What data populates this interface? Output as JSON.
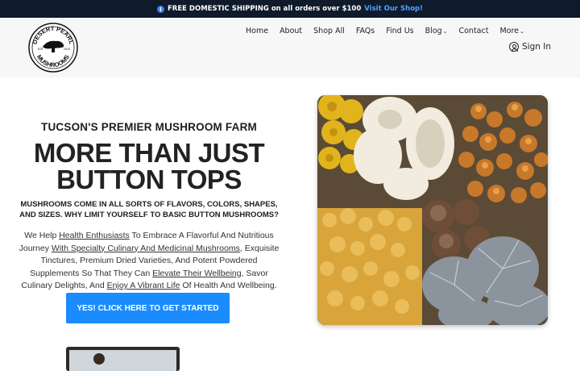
{
  "announcement": {
    "icon": "info-icon",
    "text": "FREE DOMESTIC SHIPPING on all orders over $100",
    "link": "Visit Our Shop!"
  },
  "brand": {
    "logo_top": "DESERT PEARL",
    "logo_bottom": "MUSHROOMS",
    "logo_mid_left": "EST.",
    "logo_mid_right": "2018"
  },
  "nav": {
    "items": [
      "Home",
      "About",
      "Shop All",
      "FAQs",
      "Find Us",
      "Blog",
      "Contact",
      "More"
    ],
    "signin": "Sign In"
  },
  "hero": {
    "eyebrow": "TUCSON'S PREMIER MUSHROOM FARM",
    "headline_line1": "MORE THAN JUST",
    "headline_line2": "BUTTON TOPS",
    "subhead": "MUSHROOMS COME IN ALL SORTS OF FLAVORS, COLORS, SHAPES, AND SIZES. WHY LIMIT YOURSELF TO BASIC BUTTON MUSHROOMS?",
    "body_parts": {
      "p1": "We Help ",
      "link1": "Health Enthusiasts",
      "p2": " To Embrace A Flavorful And Nutritious Journey ",
      "link2": "With Specialty Culinary And Medicinal Mushrooms",
      "p3": ", Exquisite Tinctures, Premium Dried Varieties, And Potent Powdered Supplements So That They Can ",
      "link3": "Elevate Their Wellbeing",
      "p4": ", Savor Culinary Delights, And ",
      "link4": "Enjoy A Vibrant Life",
      "p5": " Of Health And Wellbeing."
    },
    "cta": "YES! CLICK HERE TO GET STARTED"
  },
  "colors": {
    "announce_bg": "#0f1a2b",
    "link_blue": "#4ea3ff",
    "cta_blue": "#1a8cff"
  }
}
